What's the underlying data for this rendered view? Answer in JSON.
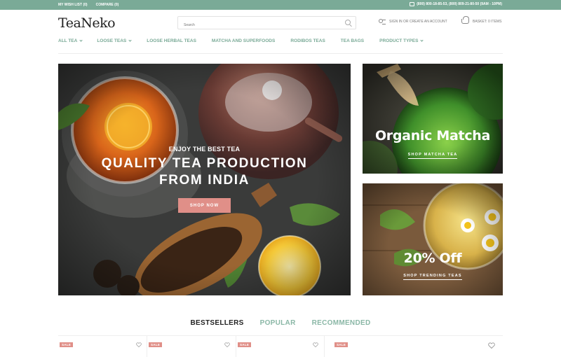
{
  "topbar": {
    "wishlist": "MY WISH LIST (0)",
    "compare": "COMPARE (0)",
    "phone_icon": "phone-icon",
    "phones": "(800) 800-18-85-53, (800) 809-21-80-50 (9AM - 10PM)"
  },
  "header": {
    "logo": "TeaNeko",
    "search_placeholder": "Search",
    "search_icon": "search-icon",
    "account_icon": "user-icon",
    "account_label": "SIGN IN OR CREATE AN ACCOUNT",
    "basket_icon": "basket-icon",
    "basket_label": "BASKET: 0 ITEMS"
  },
  "nav": {
    "items": [
      {
        "label": "ALL TEA",
        "dropdown": true
      },
      {
        "label": "LOOSE TEAS",
        "dropdown": true
      },
      {
        "label": "LOOSE HERBAL TEAS",
        "dropdown": false
      },
      {
        "label": "MATCHA AND SUPERFOODS",
        "dropdown": false
      },
      {
        "label": "RODIBOS TEAS",
        "dropdown": false
      },
      {
        "label": "TEA BAGS",
        "dropdown": false
      },
      {
        "label": "PRODUCT TYPES",
        "dropdown": true
      }
    ]
  },
  "hero": {
    "eyebrow": "ENJOY THE BEST TEA",
    "title_line1": "QUALITY TEA PRODUCTION",
    "title_line2": "FROM INDIA",
    "button": "SHOP NOW"
  },
  "promos": [
    {
      "title": "Organic Matcha",
      "link": "SHOP MATCHA TEA"
    },
    {
      "title": "20% Off",
      "link": "SHOP TRENDING TEAS"
    }
  ],
  "tabs": [
    {
      "label": "BESTSELLERS",
      "active": true
    },
    {
      "label": "POPULAR",
      "active": false
    },
    {
      "label": "RECOMMENDED",
      "active": false
    }
  ],
  "products": [
    {
      "badge": "SALE",
      "icon": "heart-icon"
    },
    {
      "badge": "SALE",
      "icon": "heart-icon"
    },
    {
      "badge": "SALE",
      "icon": "heart-icon"
    },
    {
      "badge": "SALE",
      "icon": "heart-icon"
    }
  ],
  "colors": {
    "accent": "#7aaa97",
    "button": "#e08f88",
    "tab_inactive": "#8ab7a6",
    "text_dark": "#222222"
  }
}
